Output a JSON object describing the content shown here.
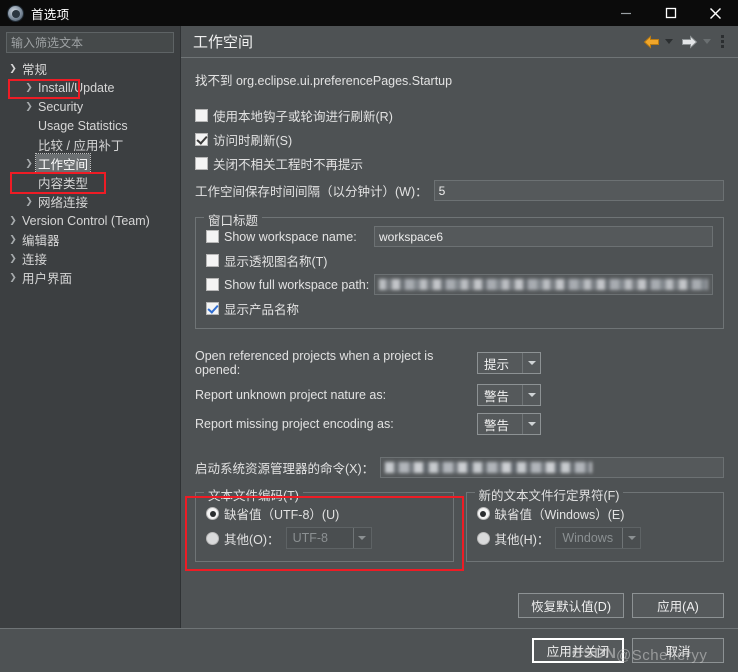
{
  "window": {
    "title": "首选项",
    "icon": "eclipse-preferences-icon",
    "minimize": "−",
    "maximize": "□",
    "close": "✕"
  },
  "sidebar": {
    "filter_placeholder": "输入筛选文本",
    "filter_value": "",
    "items": [
      {
        "label": "常规",
        "level": 0,
        "arrow": "expanded",
        "selected": false,
        "highlighted": true
      },
      {
        "label": "Install/Update",
        "level": 1,
        "arrow": "collapsed",
        "selected": false,
        "highlighted": false
      },
      {
        "label": "Security",
        "level": 1,
        "arrow": "collapsed",
        "selected": false,
        "highlighted": false
      },
      {
        "label": "Usage Statistics",
        "level": 1,
        "arrow": "none",
        "selected": false,
        "highlighted": false
      },
      {
        "label": "比较 / 应用补丁",
        "level": 1,
        "arrow": "none",
        "selected": false,
        "highlighted": false
      },
      {
        "label": "工作空间",
        "level": 1,
        "arrow": "collapsed",
        "selected": true,
        "highlighted": true
      },
      {
        "label": "内容类型",
        "level": 1,
        "arrow": "none",
        "selected": false,
        "highlighted": false
      },
      {
        "label": "网络连接",
        "level": 1,
        "arrow": "collapsed",
        "selected": false,
        "highlighted": false
      },
      {
        "label": "Version Control (Team)",
        "level": 0,
        "arrow": "collapsed",
        "selected": false,
        "highlighted": false
      },
      {
        "label": "编辑器",
        "level": 0,
        "arrow": "collapsed",
        "selected": false,
        "highlighted": false
      },
      {
        "label": "连接",
        "level": 0,
        "arrow": "collapsed",
        "selected": false,
        "highlighted": false
      },
      {
        "label": "用户界面",
        "level": 0,
        "arrow": "collapsed",
        "selected": false,
        "highlighted": false
      }
    ]
  },
  "page": {
    "title": "工作空间",
    "back_icon": "back-arrow-icon",
    "forward_icon": "forward-arrow-icon",
    "menu_icon": "kebab-menu-icon",
    "message": "找不到 org.eclipse.ui.preferencePages.Startup",
    "checkboxes": [
      {
        "label": "使用本地钩子或轮询进行刷新(R)",
        "checked": false
      },
      {
        "label": "访问时刷新(S)",
        "checked": true
      },
      {
        "label": "关闭不相关工程时不再提示",
        "checked": false
      }
    ],
    "save_interval": {
      "label": "工作空间保存时间间隔（以分钟计）(W)：",
      "value": "5"
    },
    "window_title_group": {
      "title": "窗口标题",
      "show_workspace_name": {
        "label": "Show workspace name:",
        "checked": false,
        "value": "workspace6"
      },
      "show_perspective_name": {
        "label": "显示透视图名称(T)",
        "checked": false
      },
      "show_full_path": {
        "label": "Show full workspace path:",
        "checked": false,
        "value": ""
      },
      "show_product_name": {
        "label": "显示产品名称",
        "checked": true
      }
    },
    "dropdowns": [
      {
        "label": "Open referenced projects when a project is opened:",
        "value": "提示"
      },
      {
        "label": "Report unknown project nature as:",
        "value": "警告"
      },
      {
        "label": "Report missing project encoding as:",
        "value": "警告"
      }
    ],
    "explorer_command": {
      "label": "启动系统资源管理器的命令(X)：",
      "value": ""
    },
    "encoding_group": {
      "title": "文本文件编码(T)",
      "default_option": {
        "label": "缺省值（UTF-8）(U)",
        "selected": true
      },
      "other_option": {
        "label": "其他(O)：",
        "selected": false,
        "value": "UTF-8"
      }
    },
    "delimiter_group": {
      "title": "新的文本文件行定界符(F)",
      "default_option": {
        "label": "缺省值（Windows）(E)",
        "selected": true
      },
      "other_option": {
        "label": "其他(H)：",
        "selected": false,
        "value": "Windows"
      }
    },
    "restore_defaults_label": "恢复默认值(D)",
    "apply_label": "应用(A)"
  },
  "footer": {
    "apply_and_close": "应用并关闭",
    "cancel": "取消"
  },
  "watermark": {
    "brand": "CSDN",
    "user": "@Schefferyy"
  },
  "colors": {
    "accent_back_arrow": "#f0a62a",
    "annotation_red": "#ee1c25",
    "window_bg": "#4e5254",
    "sidebar_bg": "#3c3f41",
    "titlebar_bg": "#0b0b0b",
    "check_blue": "#2f6dd0"
  }
}
